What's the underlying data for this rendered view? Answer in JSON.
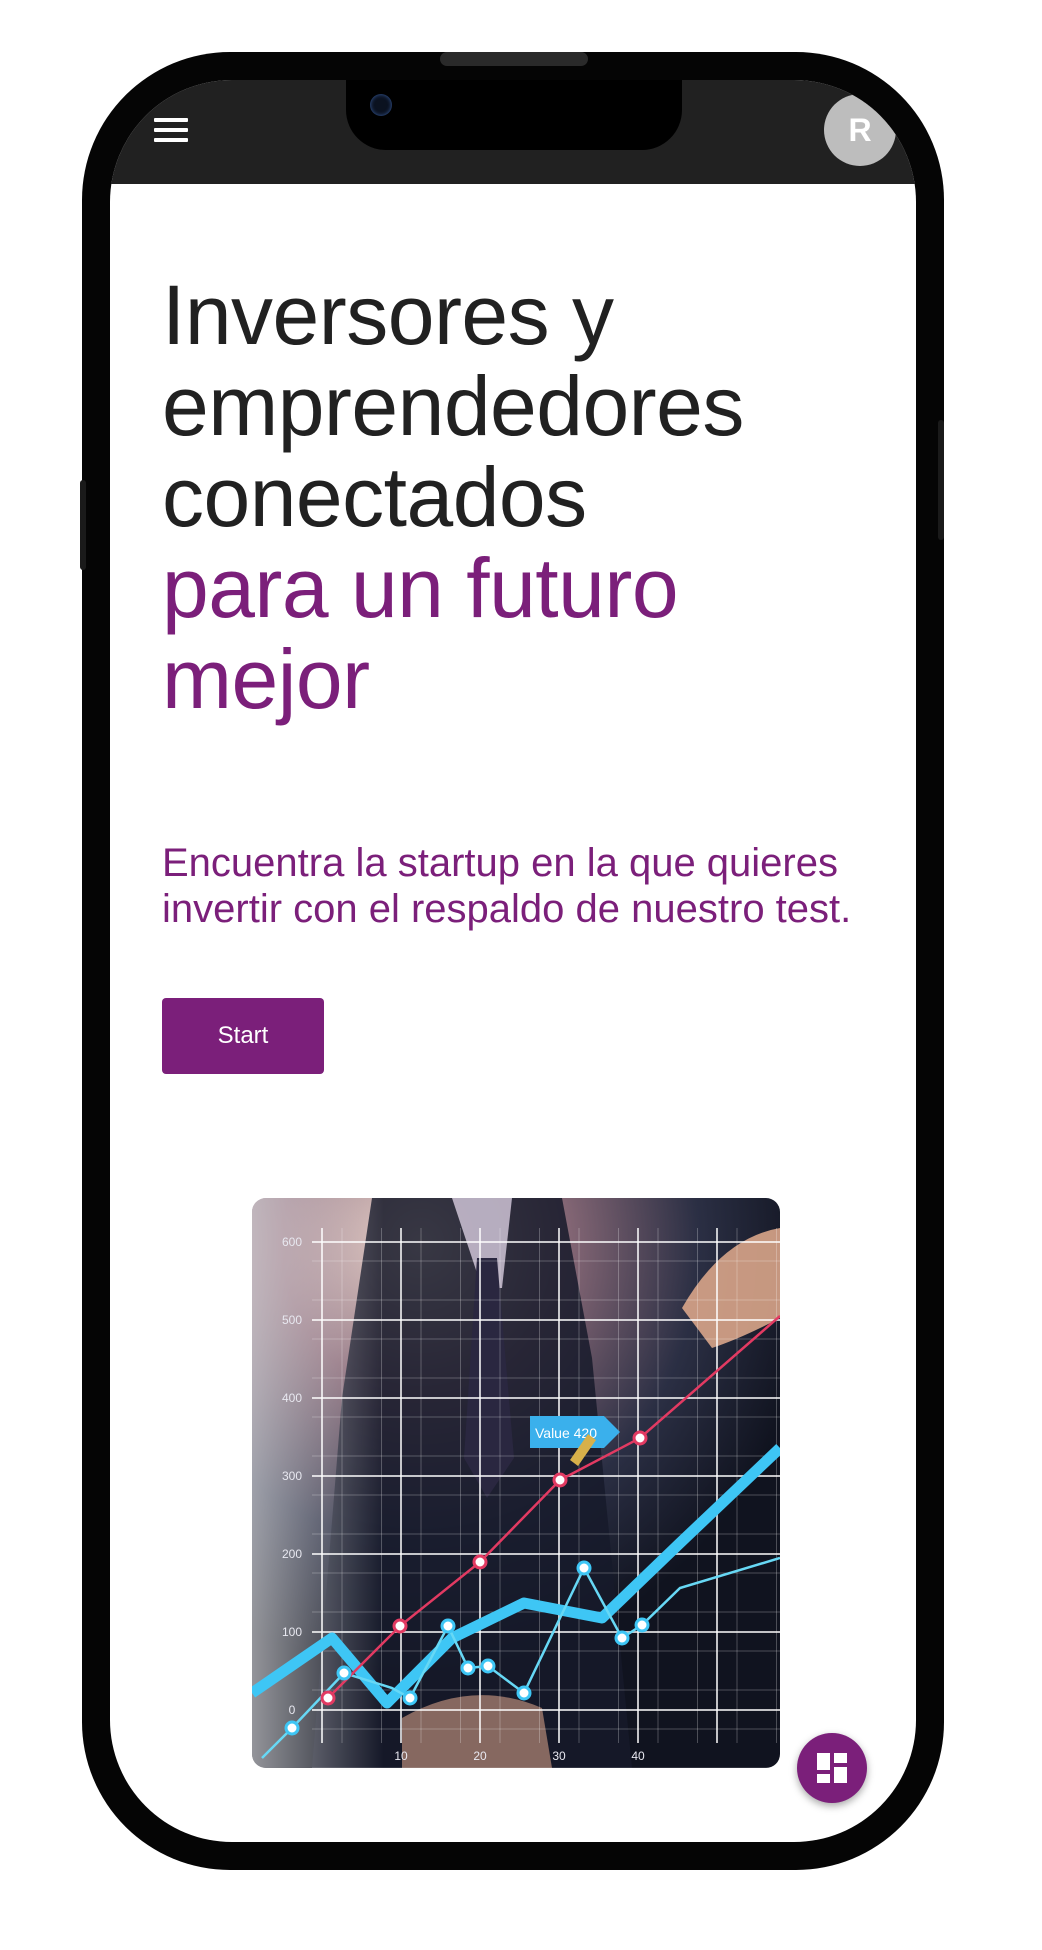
{
  "app_bar": {
    "menu_icon": "hamburger-menu-icon",
    "avatar_initial": "R",
    "background": "#212121"
  },
  "hero": {
    "headline_lines": [
      "Inversores y",
      "emprendedores",
      "conectados"
    ],
    "headline_accent_lines": [
      "para un futuro",
      "mejor"
    ],
    "subtitle": "Encuentra la startup en la que quieres invertir con el respaldo de nuestro test.",
    "start_button": "Start",
    "accent_color": "#7b1f7a",
    "text_color": "#212121"
  },
  "hero_image": {
    "y_axis_ticks": [
      "600",
      "500",
      "400",
      "300",
      "200",
      "100",
      "0"
    ],
    "x_axis_ticks": [
      "10",
      "20",
      "30",
      "40"
    ],
    "value_tag": "Value 420"
  },
  "fab": {
    "icon": "dashboard-icon"
  }
}
